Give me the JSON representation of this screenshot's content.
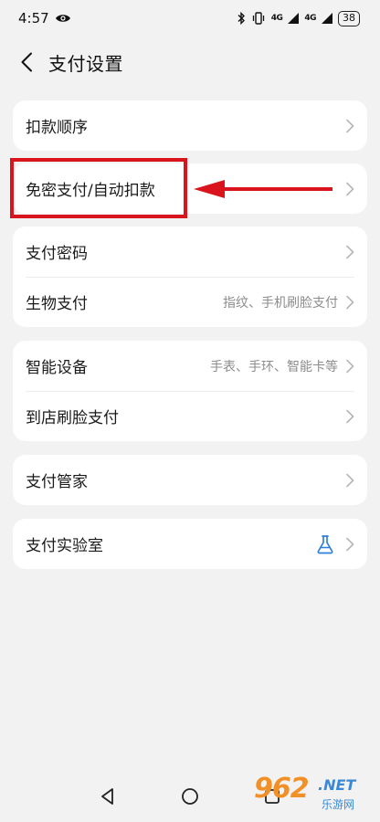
{
  "status_bar": {
    "time": "4:57",
    "signal_1": "4G",
    "signal_2": "4G",
    "battery": "38"
  },
  "header": {
    "title": "支付设置"
  },
  "groups": [
    {
      "rows": [
        {
          "label": "扣款顺序",
          "value": ""
        }
      ]
    },
    {
      "rows": [
        {
          "label": "免密支付/自动扣款",
          "value": ""
        }
      ]
    },
    {
      "rows": [
        {
          "label": "支付密码",
          "value": ""
        },
        {
          "label": "生物支付",
          "value": "指纹、手机刷脸支付"
        }
      ]
    },
    {
      "rows": [
        {
          "label": "智能设备",
          "value": "手表、手环、智能卡等"
        },
        {
          "label": "到店刷脸支付",
          "value": ""
        }
      ]
    },
    {
      "rows": [
        {
          "label": "支付管家",
          "value": ""
        }
      ]
    },
    {
      "rows": [
        {
          "label": "支付实验室",
          "value": ""
        }
      ]
    }
  ],
  "watermark": {
    "main": "962",
    "net": ".NET",
    "sub": "乐游网"
  },
  "colors": {
    "background": "#f2f2f2",
    "card": "#ffffff",
    "annotation_red": "#d9141c",
    "flask_blue": "#2f7fd6",
    "chevron": "#b5b5b5"
  }
}
